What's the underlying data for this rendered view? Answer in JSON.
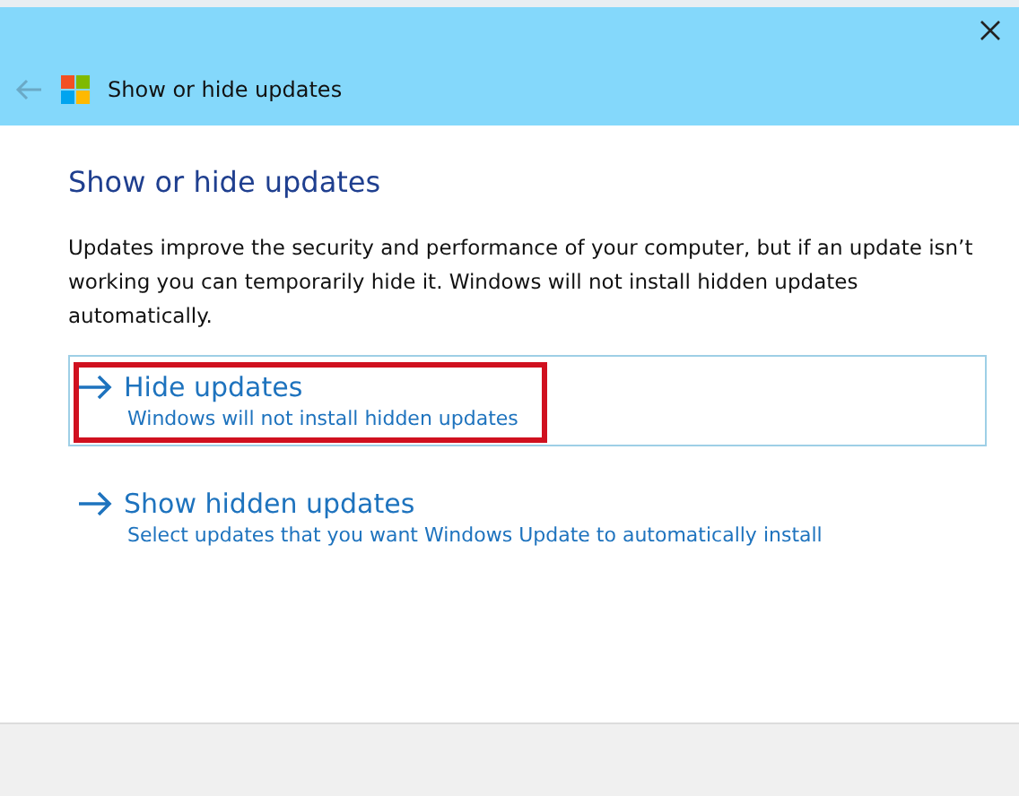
{
  "window": {
    "title": "Show or hide updates",
    "back_disabled": true
  },
  "heading": "Show or hide updates",
  "description": "Updates improve the security and performance of your computer, but if an update isn’t working you can temporarily hide it. Windows will not install hidden updates automatically.",
  "options": [
    {
      "title": "Hide updates",
      "subtitle": "Windows will not install hidden updates",
      "selected": true,
      "highlighted": true
    },
    {
      "title": "Show hidden updates",
      "subtitle": "Select updates that you want Windows Update to automatically install",
      "selected": false,
      "highlighted": false
    }
  ]
}
